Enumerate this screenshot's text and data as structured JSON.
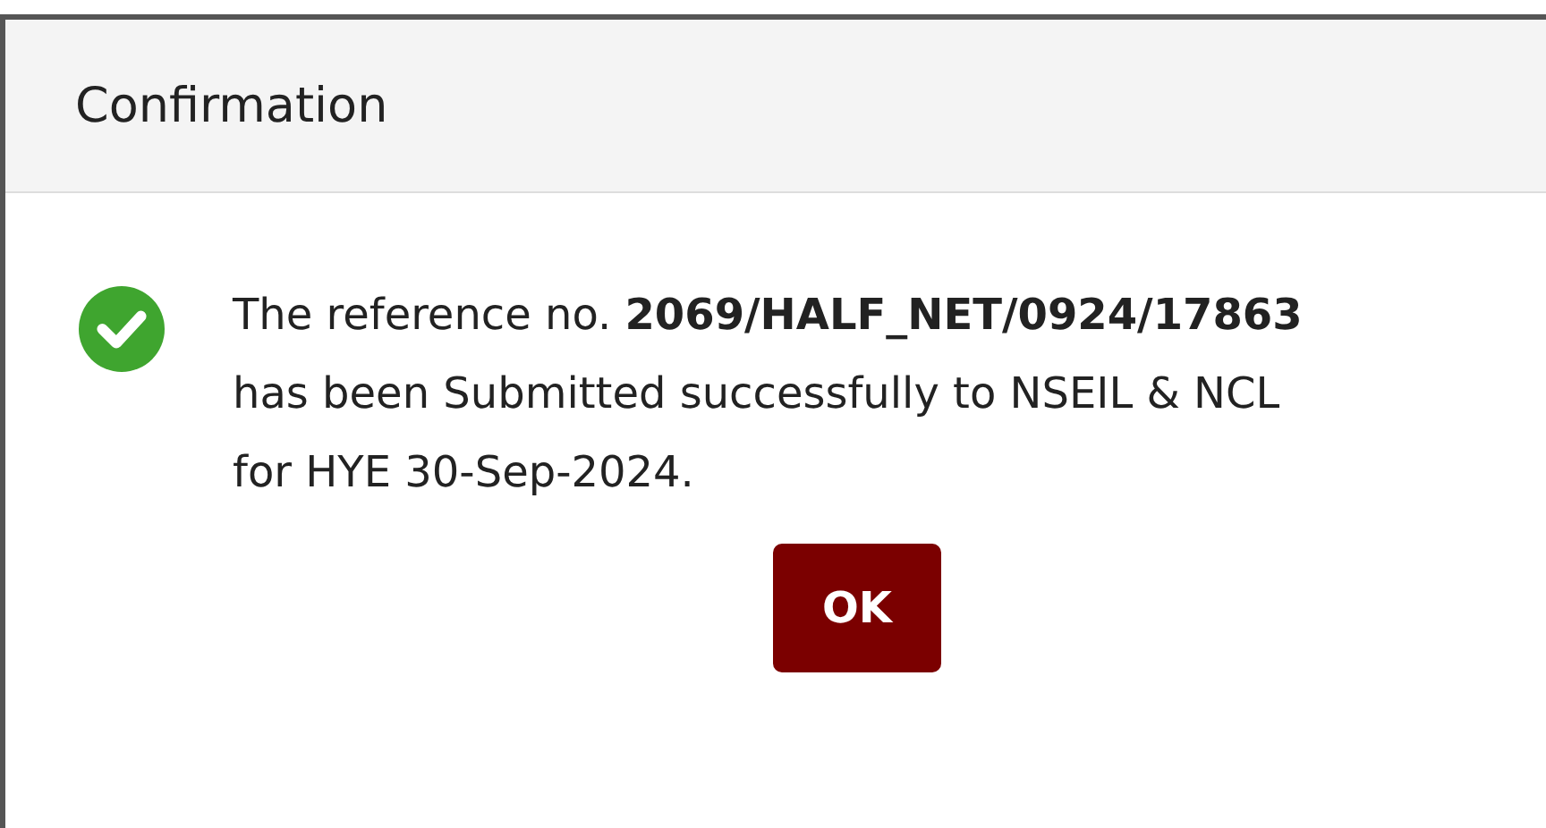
{
  "dialog": {
    "title": "Confirmation",
    "success": true,
    "message": "The reference no. **2069/HALF_NET/0924/17863** has been Submitted successfully to NSEIL & NCL for HYE 30-Sep-2024.",
    "buttons": [
      "OK"
    ]
  }
}
